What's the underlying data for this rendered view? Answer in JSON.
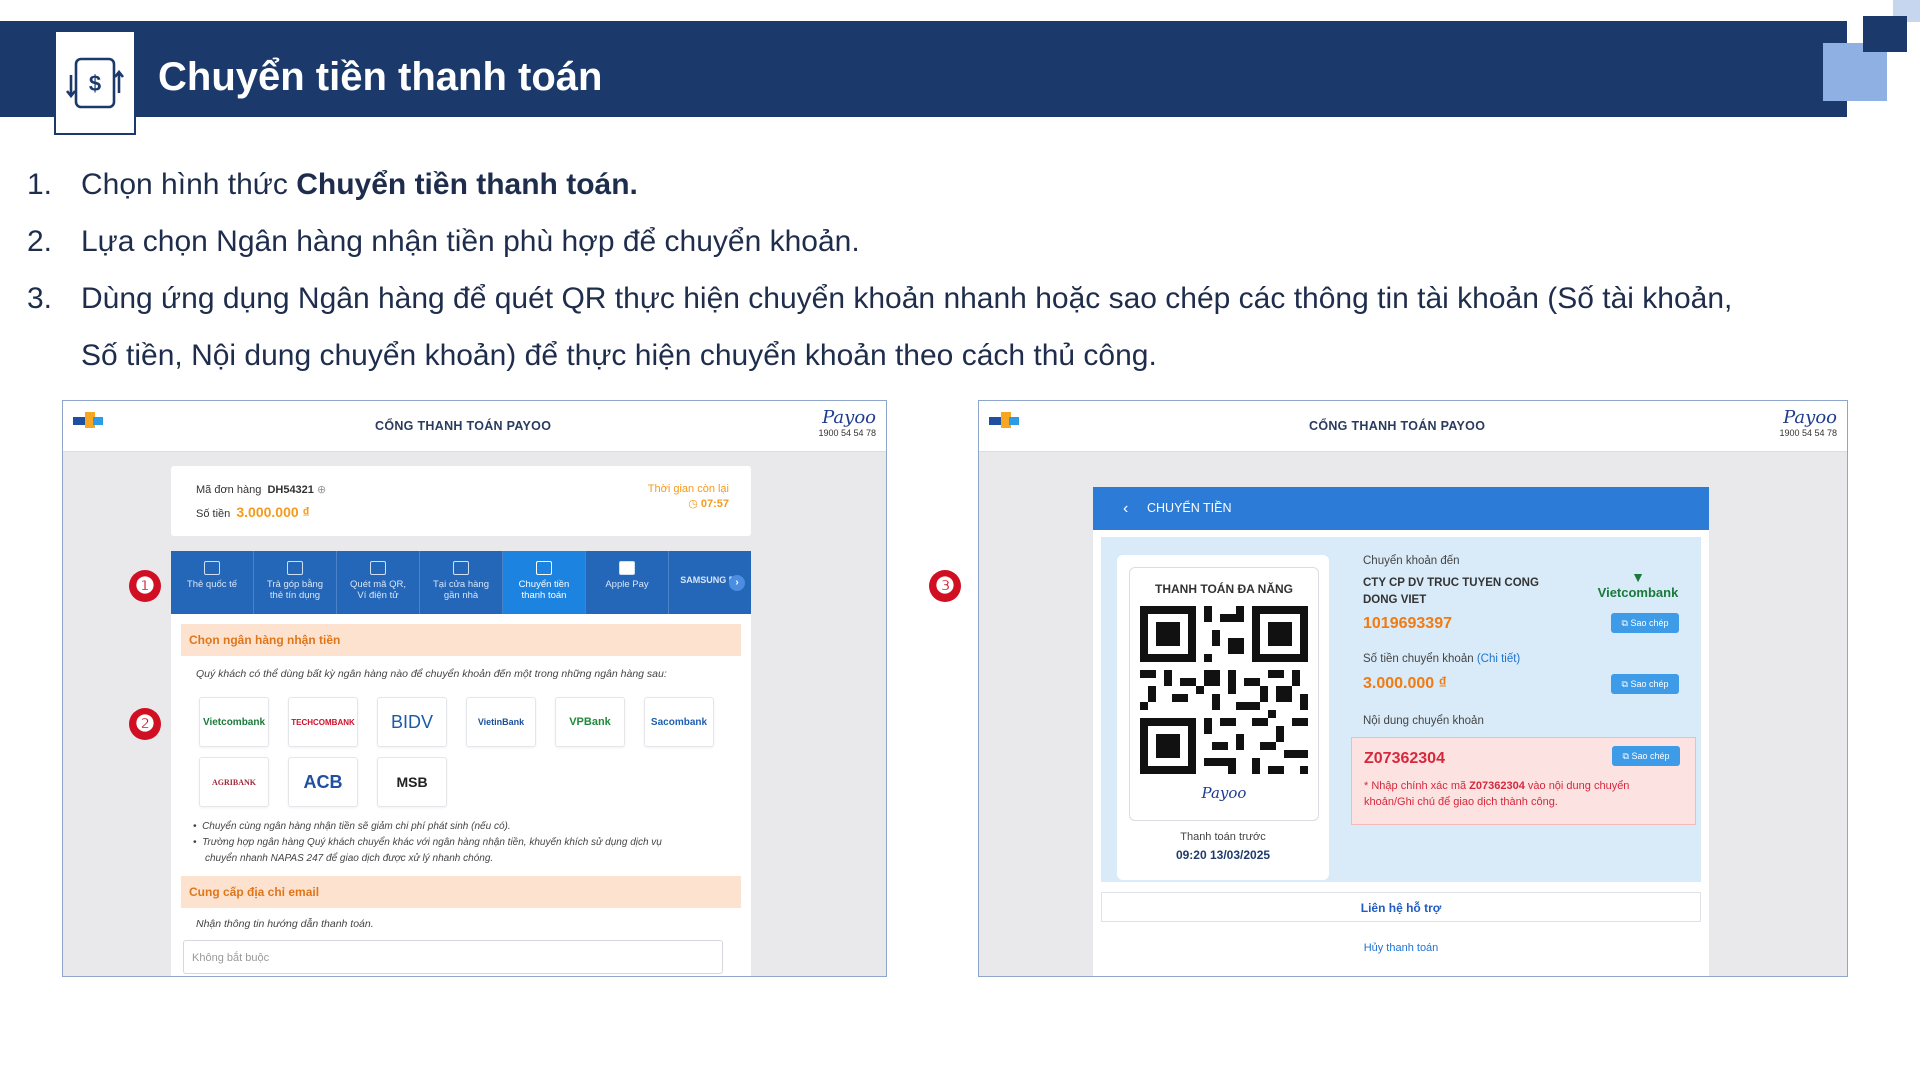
{
  "slide": {
    "title": "Chuyển tiền thanh toán",
    "steps": [
      {
        "num": "1.",
        "text_pre": "Chọn hình thức ",
        "text_bold": "Chuyển tiền thanh toán."
      },
      {
        "num": "2.",
        "text": "Lựa chọn Ngân hàng nhận tiền phù hợp để chuyển khoản."
      },
      {
        "num": "3.",
        "line1": "Dùng ứng dụng Ngân hàng để quét QR thực hiện chuyển khoản nhanh hoặc sao chép các thông tin tài khoản (Số tài khoản,",
        "line2": "Số tiền, Nội dung chuyển khoản) để thực hiện chuyển khoản theo cách thủ công."
      }
    ],
    "badges": [
      "❶",
      "❷",
      "❸"
    ]
  },
  "gateway": {
    "title": "CỔNG THANH TOÁN PAYOO",
    "brand": "Payoo",
    "hotline": "1900 54 54 78"
  },
  "left_screen": {
    "order_label": "Mã đơn hàng",
    "order_id": "DH54321",
    "amount_label": "Số tiền",
    "amount": "3.000.000 ₫",
    "timer_label": "Thời gian còn lại",
    "timer": "07:57",
    "tabs": [
      {
        "line1": "Thẻ quốc tế",
        "line2": ""
      },
      {
        "line1": "Trả góp bằng",
        "line2": "thẻ tín dụng"
      },
      {
        "line1": "Quét mã QR,",
        "line2": "Ví điện tử"
      },
      {
        "line1": "Tại cửa hàng",
        "line2": "gần nhà"
      },
      {
        "line1": "Chuyển tiền",
        "line2": "thanh toán"
      },
      {
        "line1": "Apple Pay",
        "line2": ""
      },
      {
        "line1": "SAMSUNG Pa",
        "line2": ""
      }
    ],
    "bank_section_title": "Chọn ngân hàng nhận tiền",
    "bank_section_note": "Quý khách có thể dùng bất kỳ ngân hàng nào để chuyển khoản đến một trong những ngân hàng sau:",
    "banks": [
      "Vietcombank",
      "TECHCOMBANK",
      "BIDV",
      "VietinBank",
      "VPBank",
      "Sacombank",
      "AGRIBANK",
      "ACB",
      "MSB"
    ],
    "bank_colors": {
      "vietcombank": "#1b7a3b",
      "techcombank": "#d0112b",
      "bidv": "#1a5aa6",
      "vietinbank": "#1a4f9c",
      "vpbank": "#1f8a3b",
      "sacombank": "#1f5fb0",
      "agribank": "#a0283a",
      "acb": "#1f4fa1",
      "msb": "#222222"
    },
    "bullets": [
      "Chuyển cùng ngân hàng nhận tiền sẽ giảm chi phí phát sinh (nếu có).",
      "Trường hợp ngân hàng Quý khách chuyển khác với ngân hàng nhận tiền, khuyến khích sử dụng dịch vụ",
      "chuyển nhanh NAPAS 247 để giao dịch được xử lý nhanh chóng."
    ],
    "email_section_title": "Cung cấp địa chỉ email",
    "email_note": "Nhận thông tin hướng dẫn thanh toán.",
    "email_placeholder": "Không bắt buộc"
  },
  "right_screen": {
    "back_title": "CHUYỂN TIỀN",
    "qr_title": "THANH TOÁN ĐA NĂNG",
    "qr_brand": "Payoo",
    "pay_before_label": "Thanh toán trước",
    "pay_before": "09:20 13/03/2025",
    "to_label": "Chuyển khoản đến",
    "company_line1": "CTY CP DV TRUC TUYEN CONG",
    "company_line2": "DONG VIET",
    "bank_logo": "Vietcombank",
    "account_number": "1019693397",
    "amount_label": "Số tiền chuyển khoản",
    "detail_link": "(Chi tiết)",
    "amount": "3.000.000 ₫",
    "content_label": "Nội dung chuyển khoản",
    "content_code": "Z07362304",
    "warn_pre": "* Nhập chính xác mã ",
    "warn_code": "Z07362304",
    "warn_post": " vào nội dung chuyển",
    "warn_line2": "khoản/Ghi chú để giao dịch thành công.",
    "copy_label": "Sao chép",
    "support": "Liên hệ hỗ trợ",
    "cancel": "Hủy thanh toán"
  },
  "colors": {
    "banner": "#1b3a6b",
    "accent_blue": "#2c7bd6",
    "orange": "#f07b12",
    "badge_red": "#d10f22"
  }
}
